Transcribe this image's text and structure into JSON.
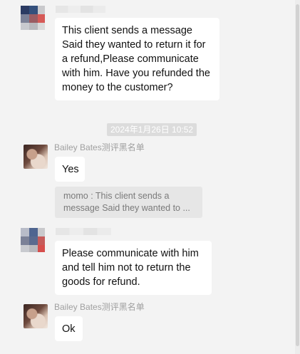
{
  "messages": [
    {
      "sender_name": "",
      "text": "This client sends a message Said they wanted to return it for a refund,Please communicate with him. Have you refunded the money to the customer?"
    },
    {
      "timestamp": "2024年1月26日 10:52"
    },
    {
      "sender_name": "Bailey Bates测评黑名单",
      "text": "Yes",
      "quote": {
        "line1": "momo : This client sends a",
        "line2": "message Said they wanted to ..."
      }
    },
    {
      "sender_name": "",
      "text": "Please communicate with him and tell him not to return the goods for refund."
    },
    {
      "sender_name": "Bailey Bates测评黑名单",
      "text": "Ok"
    }
  ],
  "colors": {
    "background": "#f3f3f3",
    "bubble": "#ffffff",
    "quote_bg": "#e6e6e6",
    "timestamp_bg": "#dcdcdc"
  }
}
